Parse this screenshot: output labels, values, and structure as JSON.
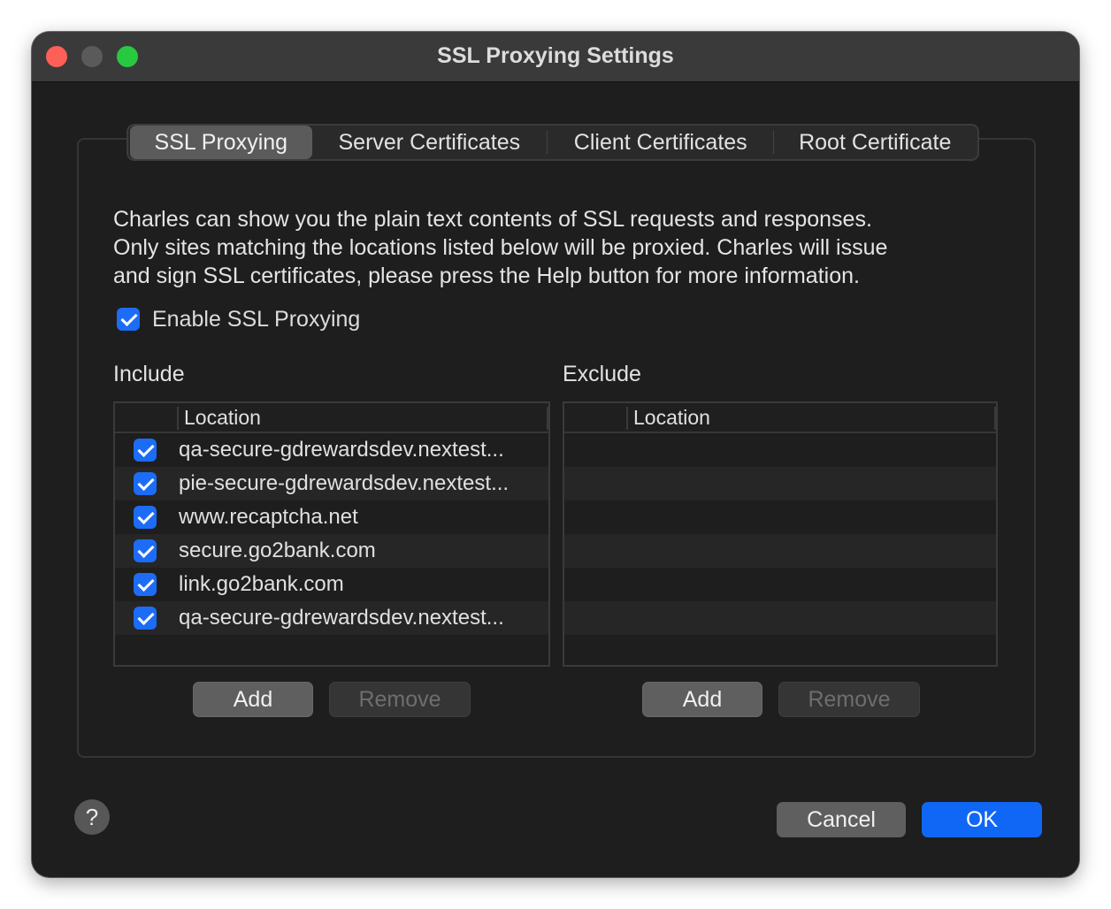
{
  "window": {
    "title": "SSL Proxying Settings"
  },
  "tabs": [
    {
      "label": "SSL Proxying",
      "active": true
    },
    {
      "label": "Server Certificates",
      "active": false
    },
    {
      "label": "Client Certificates",
      "active": false
    },
    {
      "label": "Root Certificate",
      "active": false
    }
  ],
  "description": [
    "Charles can show you the plain text contents of SSL requests and responses.",
    "Only sites matching the locations listed below will be proxied. Charles will issue",
    "and sign SSL certificates, please press the Help button for more information."
  ],
  "enable_ssl": {
    "label": "Enable SSL Proxying",
    "checked": true
  },
  "include": {
    "title": "Include",
    "column_header": "Location",
    "rows": [
      {
        "checked": true,
        "location": "qa-secure-gdrewardsdev.nextest..."
      },
      {
        "checked": true,
        "location": "pie-secure-gdrewardsdev.nextest..."
      },
      {
        "checked": true,
        "location": "www.recaptcha.net"
      },
      {
        "checked": true,
        "location": "secure.go2bank.com"
      },
      {
        "checked": true,
        "location": "link.go2bank.com"
      },
      {
        "checked": true,
        "location": "qa-secure-gdrewardsdev.nextest..."
      }
    ],
    "add_label": "Add",
    "remove_label": "Remove"
  },
  "exclude": {
    "title": "Exclude",
    "column_header": "Location",
    "rows": [],
    "add_label": "Add",
    "remove_label": "Remove"
  },
  "footer": {
    "help_label": "?",
    "cancel_label": "Cancel",
    "ok_label": "OK"
  },
  "colors": {
    "accent": "#1167f5",
    "checkbox": "#1c6cf6",
    "window_bg": "#1e1e1e",
    "close": "#fe5f57",
    "maximize": "#28c840"
  }
}
